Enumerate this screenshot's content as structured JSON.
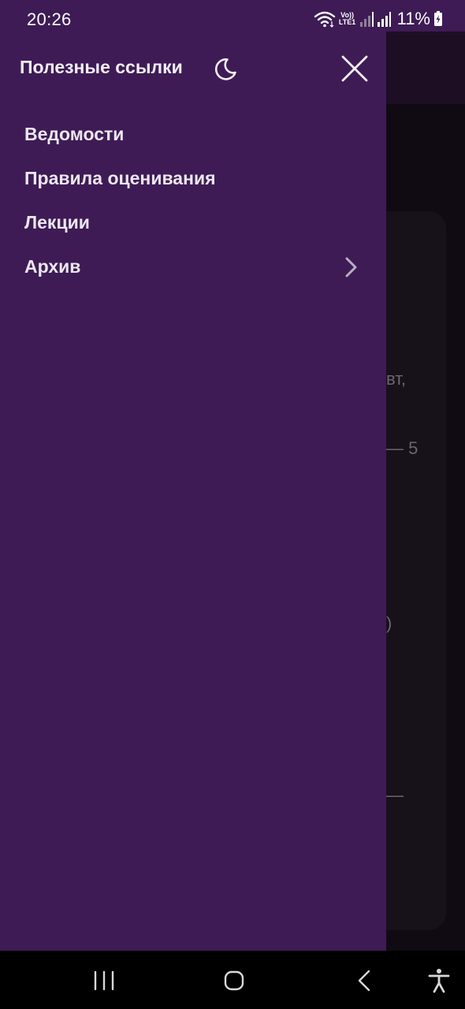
{
  "status_bar": {
    "time": "20:26",
    "volte_label": "Vo))",
    "lte_label": "LTE1",
    "battery": "11%",
    "icons": [
      "wifi-icon",
      "volte-lte-icon",
      "signal-bars-icon",
      "signal-bars-icon",
      "battery-charging-icon"
    ]
  },
  "drawer": {
    "title": "Полезные ссылки",
    "theme_icon": "moon-icon",
    "close_icon": "close-icon",
    "items": [
      {
        "label": "Ведомости",
        "has_submenu": false
      },
      {
        "label": "Правила оценивания",
        "has_submenu": false
      },
      {
        "label": "Лекции",
        "has_submenu": false
      },
      {
        "label": "Архив",
        "has_submenu": true,
        "icon": "chevron-right-icon"
      }
    ]
  },
  "background_fragments": [
    "вт,",
    "— 5",
    ")",
    "—"
  ],
  "nav_bar": {
    "icons": [
      "recent-apps-icon",
      "home-icon",
      "back-icon",
      "accessibility-icon"
    ]
  },
  "colors": {
    "drawer_bg": "#3e1b55",
    "header_dim": "#1e0e24",
    "background": "#100b12",
    "text": "#ece6f0",
    "nav_bg": "#000000"
  }
}
